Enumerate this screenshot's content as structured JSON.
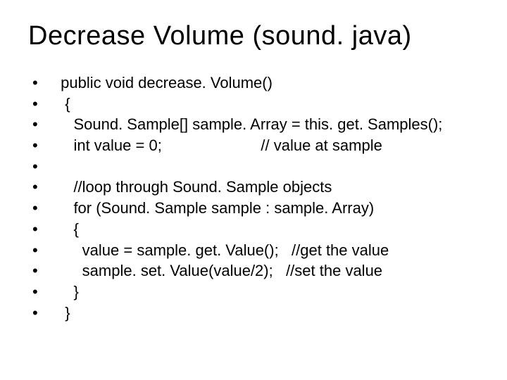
{
  "title": "Decrease Volume (sound. java)",
  "bullet_char": "•",
  "lines": [
    " public void decrease. Volume()",
    "  {",
    "    Sound. Sample[] sample. Array = this. get. Samples();",
    "    int value = 0;                       // value at sample",
    "",
    "    //loop through Sound. Sample objects",
    "    for (Sound. Sample sample : sample. Array)",
    "    {",
    "      value = sample. get. Value();   //get the value",
    "      sample. set. Value(value/2);   //set the value",
    "    }",
    "  }"
  ]
}
